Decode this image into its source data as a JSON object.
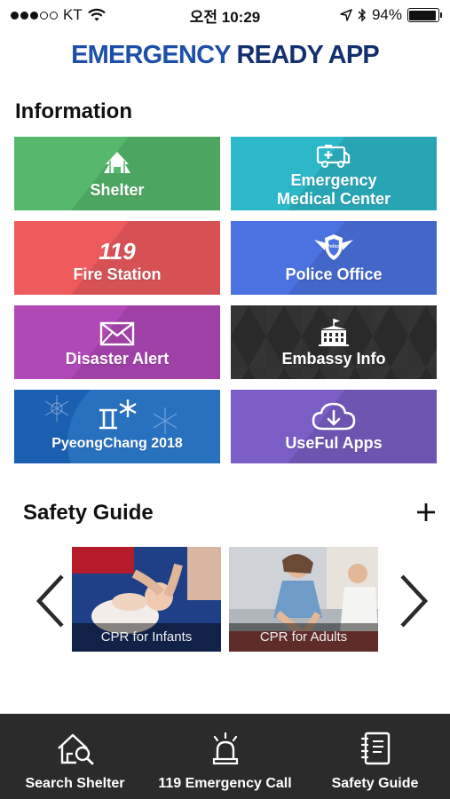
{
  "status_bar": {
    "carrier": "KT",
    "time": "오전 10:29",
    "battery": "94%",
    "battery_level": 0.94,
    "signal_bars": 3,
    "signal_max": 5
  },
  "app": {
    "title_part1": "EMERGENCY ",
    "title_part2": "READY APP"
  },
  "information": {
    "heading": "Information",
    "tiles": [
      {
        "label": "Shelter",
        "icon": "shelter-icon",
        "color": "#55b86c"
      },
      {
        "label_line1": "Emergency",
        "label_line2": "Medical Center",
        "icon": "ambulance-icon",
        "color": "#2cb8c9"
      },
      {
        "label": "Fire Station",
        "icon": "119-logo-icon",
        "icon_text": "119",
        "color": "#ee5b5d"
      },
      {
        "label": "Police Office",
        "icon": "police-badge-icon",
        "icon_text": "Police",
        "color": "#4a72e0"
      },
      {
        "label": "Disaster Alert",
        "icon": "envelope-icon",
        "color": "#b048b8"
      },
      {
        "label": "Embassy Info",
        "icon": "embassy-building-icon",
        "color": "#2a2a2a"
      },
      {
        "label": "PyeongChang 2018",
        "icon": "pyeongchang-logo-icon",
        "color": "#1a5fb0"
      },
      {
        "label": "UseFul Apps",
        "icon": "cloud-download-icon",
        "color": "#7a5ec6"
      }
    ]
  },
  "safety_guide": {
    "heading": "Safety Guide",
    "cards": [
      {
        "caption": "CPR for Infants"
      },
      {
        "caption": "CPR for Adults"
      }
    ]
  },
  "tab_bar": {
    "tabs": [
      {
        "label": "Search Shelter",
        "icon": "search-shelter-icon"
      },
      {
        "label": "119 Emergency Call",
        "icon": "siren-icon"
      },
      {
        "label": "Safety Guide",
        "icon": "guide-book-icon"
      }
    ]
  }
}
